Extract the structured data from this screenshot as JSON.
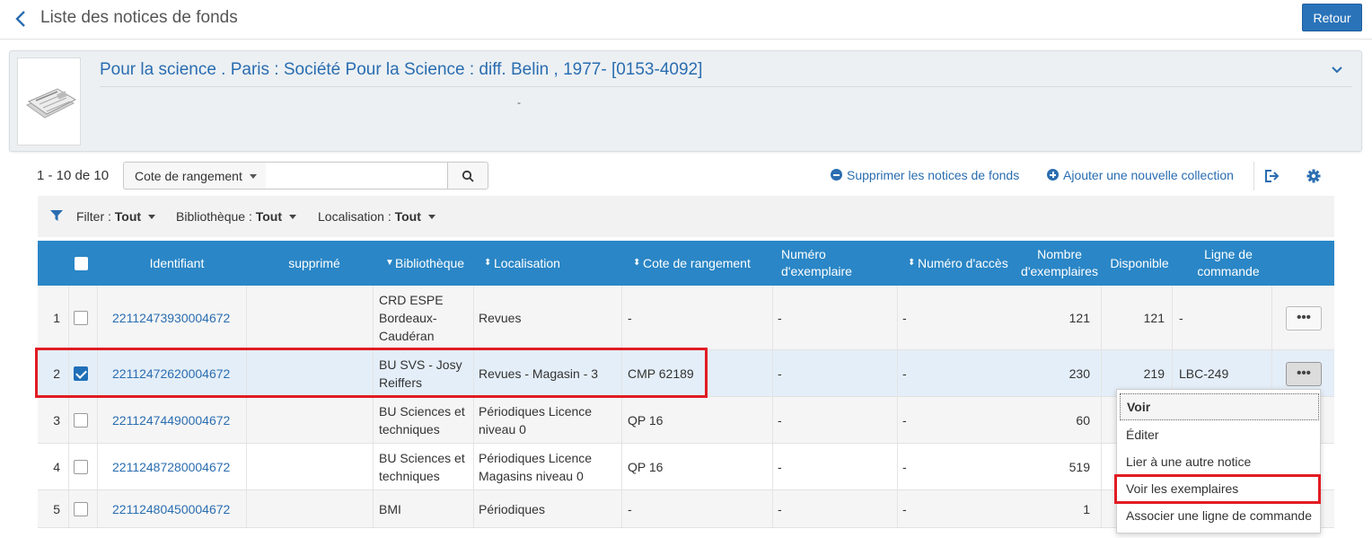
{
  "header": {
    "title": "Liste des notices de fonds",
    "back_button": "Retour"
  },
  "record": {
    "title": "Pour la science . Paris : Société Pour la Science : diff. Belin , 1977- [0153-4092]",
    "subtitle": "-"
  },
  "toolbar": {
    "count": "1 - 10 de 10",
    "search_field": "Cote de rangement",
    "search_value": "",
    "delete_label": "Supprimer les notices de fonds",
    "add_label": "Ajouter une nouvelle collection"
  },
  "filters": [
    {
      "label": "Filter :",
      "value": "Tout"
    },
    {
      "label": "Bibliothèque :",
      "value": "Tout"
    },
    {
      "label": "Localisation :",
      "value": "Tout"
    }
  ],
  "table": {
    "columns": {
      "identifiant": "Identifiant",
      "supprime": "supprimé",
      "bibliotheque": "Bibliothèque",
      "localisation": "Localisation",
      "cote": "Cote de rangement",
      "numero_exemplaire": "Numéro d'exemplaire",
      "numero_acces": "Numéro d'accès",
      "nombre_exemplaires": "Nombre d'exemplaires",
      "disponible": "Disponible",
      "ligne_commande": "Ligne de commande"
    },
    "rows": [
      {
        "num": "1",
        "id": "22112473930004672",
        "supprime": "",
        "bibliotheque": "CRD ESPE Bordeaux-Caudéran",
        "localisation": "Revues",
        "cote": "-",
        "num_ex": "-",
        "num_acces": "-",
        "nombre": "121",
        "dispo": "121",
        "ligne": "-"
      },
      {
        "num": "2",
        "id": "22112472620004672",
        "supprime": "",
        "bibliotheque": "BU SVS - Josy Reiffers",
        "localisation": "Revues - Magasin - 3",
        "cote": "CMP 62189",
        "num_ex": "-",
        "num_acces": "-",
        "nombre": "230",
        "dispo": "219",
        "ligne": "LBC-249"
      },
      {
        "num": "3",
        "id": "22112474490004672",
        "supprime": "",
        "bibliotheque": "BU Sciences et techniques",
        "localisation": "Périodiques Licence niveau 0",
        "cote": "QP 16",
        "num_ex": "-",
        "num_acces": "-",
        "nombre": "60",
        "dispo": "",
        "ligne": ""
      },
      {
        "num": "4",
        "id": "22112487280004672",
        "supprime": "",
        "bibliotheque": "BU Sciences et techniques",
        "localisation": "Périodiques Licence Magasins niveau 0",
        "cote": "QP 16",
        "num_ex": "-",
        "num_acces": "-",
        "nombre": "519",
        "dispo": "",
        "ligne": ""
      },
      {
        "num": "5",
        "id": "22112480450004672",
        "supprime": "",
        "bibliotheque": "BMI",
        "localisation": "Périodiques",
        "cote": "-",
        "num_ex": "-",
        "num_acces": "-",
        "nombre": "1",
        "dispo": "",
        "ligne": ""
      }
    ],
    "row_menu_label": "•••"
  },
  "menu": {
    "items": [
      "Voir",
      "Éditer",
      "Lier à une autre notice",
      "Voir les exemplaires",
      "Associer une ligne de commande"
    ]
  },
  "icons": {
    "back": "chevron-left-icon",
    "collapse": "chevron-down-icon",
    "search": "search-icon",
    "export": "export-icon",
    "settings": "gear-icon",
    "filter": "filter-icon"
  },
  "colors": {
    "accent": "#2a73b9",
    "header_row": "#2a86c6",
    "highlight": "#e11c23"
  }
}
